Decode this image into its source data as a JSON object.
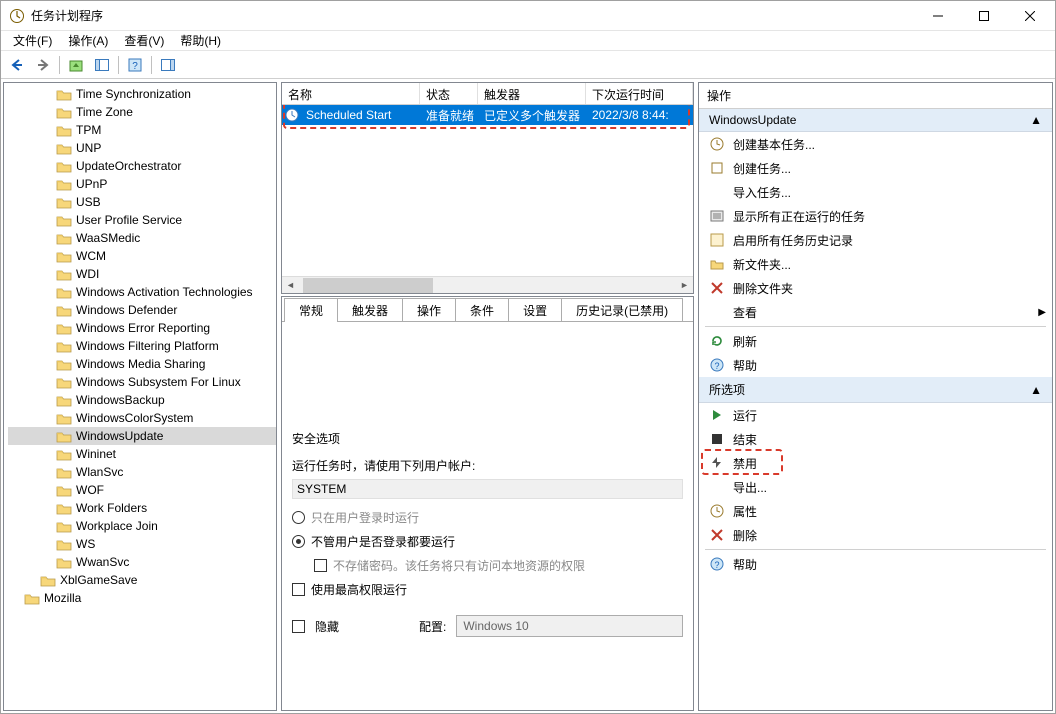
{
  "window": {
    "title": "任务计划程序"
  },
  "menu": {
    "file": "文件(F)",
    "action": "操作(A)",
    "view": "查看(V)",
    "help": "帮助(H)"
  },
  "tree": {
    "items": [
      "Time Synchronization",
      "Time Zone",
      "TPM",
      "UNP",
      "UpdateOrchestrator",
      "UPnP",
      "USB",
      "User Profile Service",
      "WaaSMedic",
      "WCM",
      "WDI",
      "Windows Activation Technologies",
      "Windows Defender",
      "Windows Error Reporting",
      "Windows Filtering Platform",
      "Windows Media Sharing",
      "Windows Subsystem For Linux",
      "WindowsBackup",
      "WindowsColorSystem",
      "WindowsUpdate",
      "Wininet",
      "WlanSvc",
      "WOF",
      "Work Folders",
      "Workplace Join",
      "WS",
      "WwanSvc"
    ],
    "tail0": "XblGameSave",
    "tail1": "Mozilla",
    "selected": "WindowsUpdate"
  },
  "list": {
    "cols": {
      "name": "名称",
      "status": "状态",
      "trigger": "触发器",
      "next": "下次运行时间"
    },
    "row": {
      "name": "Scheduled Start",
      "status": "准备就绪",
      "trigger": "已定义多个触发器",
      "next": "2022/3/8 8:44:"
    }
  },
  "detail": {
    "tabs": {
      "general": "常规",
      "triggers": "触发器",
      "actions": "操作",
      "conditions": "条件",
      "settings": "设置",
      "history": "历史记录(已禁用)"
    },
    "security_section": "安全选项",
    "run_as_label": "运行任务时，请使用下列用户帐户:",
    "account": "SYSTEM",
    "radio_logon": "只在用户登录时运行",
    "radio_any": "不管用户是否登录都要运行",
    "no_store_pw": "不存储密码。该任务将只有访问本地资源的权限",
    "highest_priv": "使用最高权限运行",
    "hidden": "隐藏",
    "config_label": "配置:",
    "config_value": "Windows 10"
  },
  "actions": {
    "title": "操作",
    "group1": "WindowsUpdate",
    "g1": {
      "create_basic": "创建基本任务...",
      "create": "创建任务...",
      "import": "导入任务...",
      "show_running": "显示所有正在运行的任务",
      "enable_history": "启用所有任务历史记录",
      "new_folder": "新文件夹...",
      "delete_folder": "删除文件夹",
      "view": "查看",
      "refresh": "刷新",
      "help": "帮助"
    },
    "group2": "所选项",
    "g2": {
      "run": "运行",
      "end": "结束",
      "disable": "禁用",
      "export": "导出...",
      "properties": "属性",
      "delete": "删除",
      "help": "帮助"
    }
  }
}
